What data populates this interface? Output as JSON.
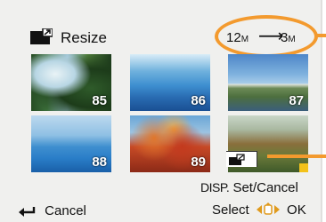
{
  "header": {
    "title": "Resize",
    "size_from_num": "12",
    "size_from_unit": "M",
    "size_to_num": "3",
    "size_to_unit": "M",
    "arrow": "⟶"
  },
  "thumbnails": [
    {
      "number": "85"
    },
    {
      "number": "86"
    },
    {
      "number": "87"
    },
    {
      "number": "88"
    },
    {
      "number": "89"
    },
    {
      "number": ""
    }
  ],
  "footer": {
    "disp_label": "DISP.",
    "set_cancel": "Set/Cancel",
    "cancel": "Cancel",
    "select": "Select",
    "ok": "OK"
  },
  "colors": {
    "callout": "#f39a2e",
    "selected_badge": "#f3c21a",
    "screen_bg": "#f0f0ee"
  },
  "icons": {
    "resize": "resize-icon",
    "back": "return-arrow-icon",
    "nav": "cursor-buttons-icon"
  }
}
